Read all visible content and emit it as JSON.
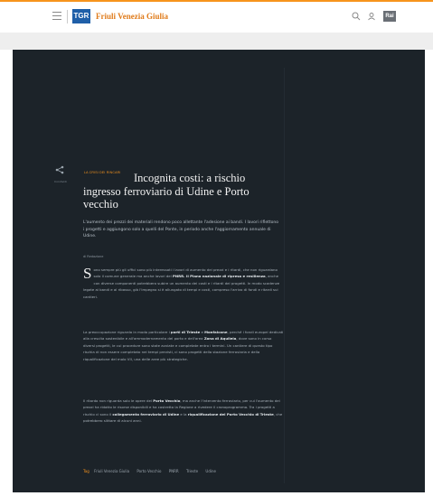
{
  "header": {
    "region_title": "Friuli Venezia Giulia",
    "logo_text": "TGR",
    "rai_text": "Rai"
  },
  "share": {
    "label": "Condividi"
  },
  "article": {
    "kicker": "LA CRISI DEI RINCARI",
    "title": "Incognita costi: a rischio ingresso ferroviario di Udine e Porto vecchio",
    "summary": "L'aumento dei prezzi dei materiali rendono poco allettante l'adesione ai bandi. I lavori riflettono i progetti e aggiungono solo a quelli del Ponte, in periodo anche l'aggiornamento annuale di Udine.",
    "author": "di Redazione",
    "dropcap": "S",
    "p1_a": "ono sempre più gli uffici sono più interessati i lavori di aumento dei prezzi e i ritardi, che non riguardano solo il comune generale ma anche lavori del ",
    "p1_b": "PNRR. Il Piano nazionale di ripresa e resilienza",
    "p1_c": ", anche con diverse componenti potrebbero subire un aumento dei costi e i ritardi dei progetti. In modo scadenze legate ai bandi e al ribasso, già l'impegno si è allungato di tempi e costi, compreso l'arrivo di fondi e ritardi sui cantieri.",
    "p2_a": "La preoccupazione riguarda in modo particolare i ",
    "p2_b": "porti di Trieste",
    "p2_c": " e ",
    "p2_d": "Monfalcone",
    "p2_e": ", perché i fondi europei dedicati alla crescita sostenibile e all'ammodernamento del porto e dell'area ",
    "p2_f": "Zona di Aquileia",
    "p2_g": ", dove sono in corso diversi progetti, le cui procedure sono state avviate e completate entro i termini. Un cantiere di questo tipo rischia di non essere completato nei tempi previsti, ci sono progetti della stazione ferroviaria e della riqualificazione del molo VII, una delle aree più strategiche.",
    "p3_a": "Il ritardo non riguarda solo le opere del ",
    "p3_b": "Porto Vecchio",
    "p3_c": ", ma anche l'intervento ferroviario, per cui l'aumento dei prezzi ha ridotto le risorse disponibili e ha costretto la Regione a rivedere il cronoprogramma. Tra i progetti a rischio ci sono il ",
    "p3_d": "collegamento ferroviario di Udine",
    "p3_e": " e la ",
    "p3_f": "riqualificazione del Porto Vecchio di Trieste",
    "p3_g": ", che potrebbero slittare di alcuni anni.",
    "tags_label": "Tag",
    "tags": [
      "Friuli Venezia Giulia",
      "Porto Vecchio",
      "PNRR",
      "Trieste",
      "Udine"
    ]
  },
  "colors": {
    "accent": "#f7941d",
    "hero_bg": "#1c2329",
    "logo_blue": "#1f5fa8"
  }
}
